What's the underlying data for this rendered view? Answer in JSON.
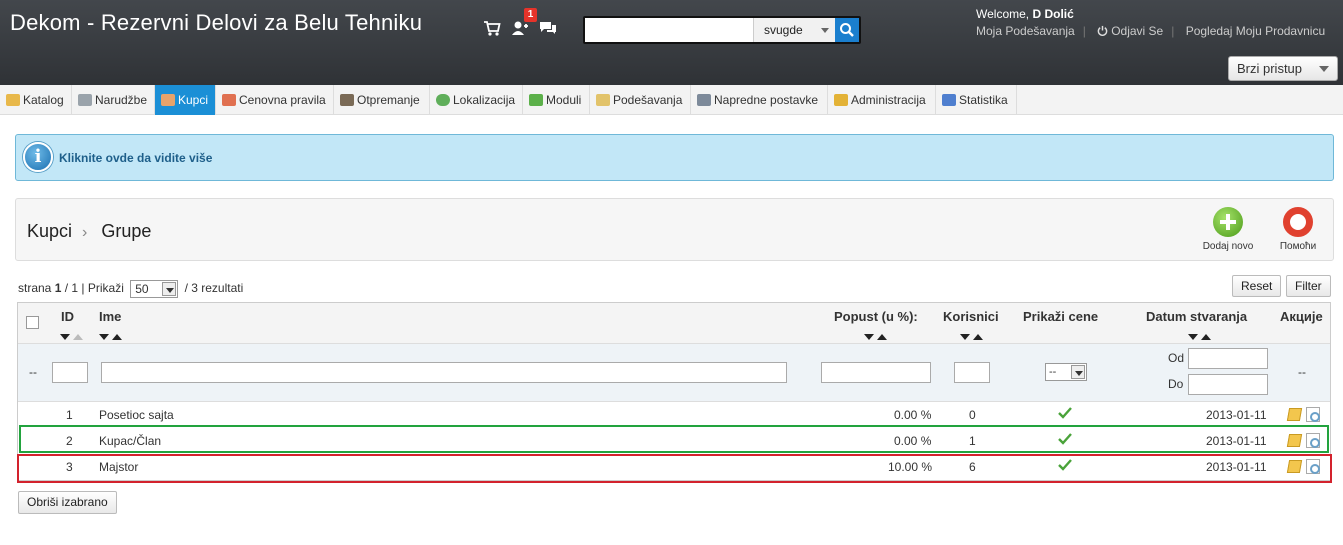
{
  "header": {
    "title": "Dekom - Rezervni Delovi za Belu Tehniku",
    "notifications_count": "1",
    "search": {
      "placeholder": "",
      "scope": "svugde"
    },
    "welcome_prefix": "Welcome, ",
    "welcome_user": "D Dolić",
    "links": {
      "settings": "Moja Podešavanja",
      "logout": "Odjavi Se",
      "view_store": "Pogledaj Moju Prodavnicu"
    },
    "quick_access": "Brzi pristup"
  },
  "nav": {
    "items": [
      {
        "label": "Katalog",
        "icon": "folder-icon",
        "color": "#e8b84a"
      },
      {
        "label": "Narudžbe",
        "icon": "cart-icon",
        "color": "#9aa3ab"
      },
      {
        "label": "Kupci",
        "icon": "customer-icon",
        "color": "#e7a36b",
        "active": true
      },
      {
        "label": "Cenovna pravila",
        "icon": "calendar-icon",
        "color": "#e07050"
      },
      {
        "label": "Otpremanje",
        "icon": "truck-icon",
        "color": "#7a6a56"
      },
      {
        "label": "Lokalizacija",
        "icon": "globe-icon",
        "color": "#5fae5a"
      },
      {
        "label": "Moduli",
        "icon": "puzzle-icon",
        "color": "#5cb04a"
      },
      {
        "label": "Podešavanja",
        "icon": "settings-icon",
        "color": "#e2c36a"
      },
      {
        "label": "Napredne postavke",
        "icon": "wrench-icon",
        "color": "#7d8a9a"
      },
      {
        "label": "Administracija",
        "icon": "key-icon",
        "color": "#e3b236"
      },
      {
        "label": "Statistika",
        "icon": "chart-icon",
        "color": "#4f7fcf"
      }
    ]
  },
  "info": {
    "text": "Kliknite ovde da vidite više"
  },
  "toolbar": {
    "breadcrumb": [
      "Kupci",
      "Grupe"
    ],
    "add_label": "Dodaj novo",
    "help_label": "Помоћи"
  },
  "list": {
    "pager": {
      "prefix": "strana",
      "page": "1",
      "sep": "/ 1 | Prikaži",
      "per_page": "50",
      "results": "/ 3 rezultati"
    },
    "reset_label": "Reset",
    "filter_label": "Filter",
    "columns": {
      "id": "ID",
      "name": "Ime",
      "discount": "Popust (u %):",
      "members": "Korisnici",
      "show_prices": "Prikaži cene",
      "created": "Datum stvaranja",
      "actions": "Акције"
    },
    "filters": {
      "dash": "--",
      "show_prices": "--",
      "from": "Od",
      "to": "Do",
      "actions": "--"
    },
    "rows": [
      {
        "id": "1",
        "name": "Posetioc sajta",
        "discount": "0.00 %",
        "members": "0",
        "date": "2013-01-11"
      },
      {
        "id": "2",
        "name": "Kupac/Član",
        "discount": "0.00 %",
        "members": "1",
        "date": "2013-01-11"
      },
      {
        "id": "3",
        "name": "Majstor",
        "discount": "10.00 %",
        "members": "6",
        "date": "2013-01-11"
      }
    ],
    "delete_selected": "Obriši izabrano"
  }
}
